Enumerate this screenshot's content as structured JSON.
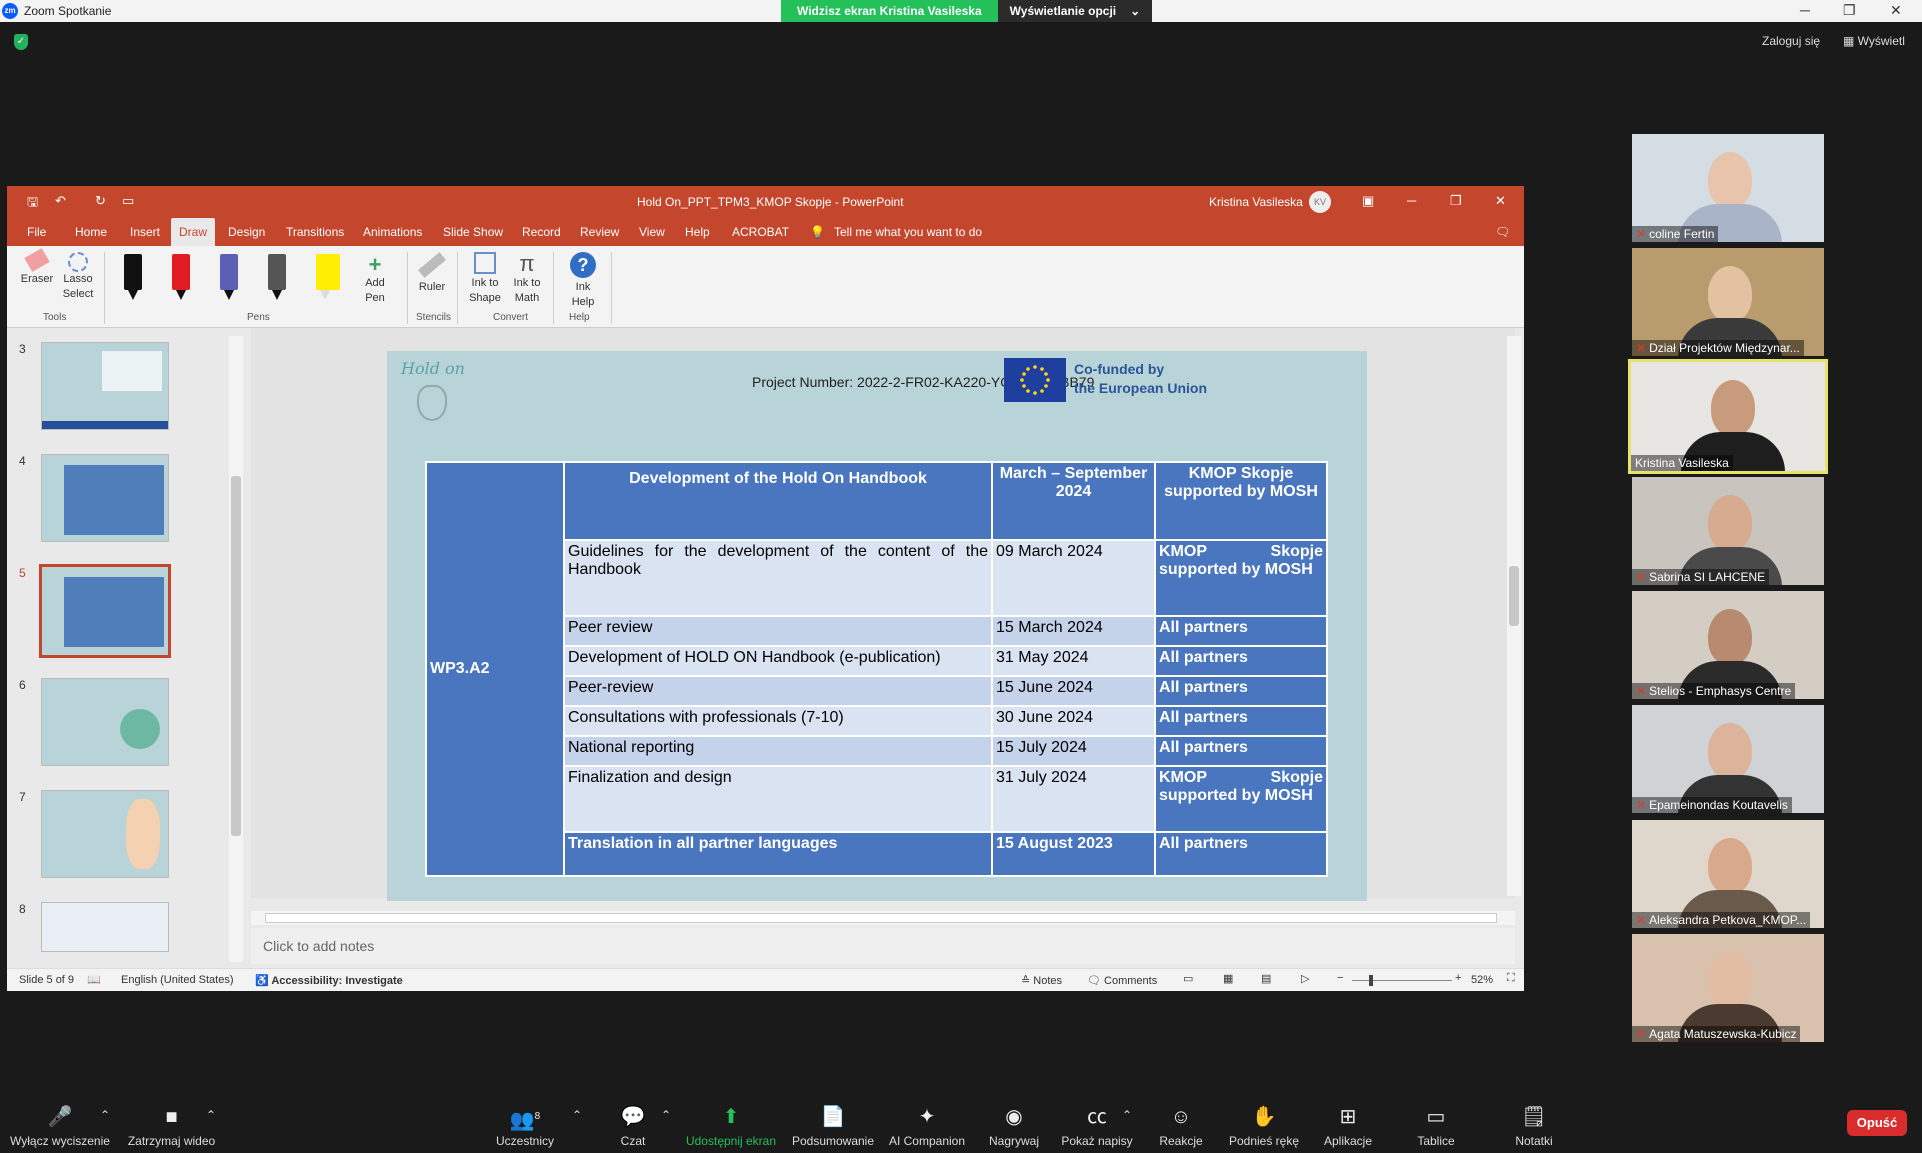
{
  "zoom": {
    "window_title": "Zoom Spotkanie",
    "app_icon": "zm",
    "share_banner": "Widzisz ekran Kristina Vasileska",
    "view_options": "Wyświetlanie opcji",
    "login": "Zaloguj się",
    "view": "Wyświetl"
  },
  "ppt": {
    "title": "Hold On_PPT_TPM3_KMOP Skopje  -  PowerPoint",
    "user": "Kristina Vasileska",
    "user_initials": "KV",
    "tabs": [
      "File",
      "Home",
      "Insert",
      "Draw",
      "Design",
      "Transitions",
      "Animations",
      "Slide Show",
      "Record",
      "Review",
      "View",
      "Help",
      "ACROBAT"
    ],
    "tell_me": "Tell me what you want to do",
    "ribbon": {
      "eraser": "Eraser",
      "lasso": "Lasso Select",
      "tools_group": "Tools",
      "add_pen": "Add Pen",
      "pens_group": "Pens",
      "ruler": "Ruler",
      "stencils_group": "Stencils",
      "ink_to_shape": "Ink to Shape",
      "ink_to_math": "Ink to Math",
      "convert_group": "Convert",
      "ink_help": "Ink Help",
      "help_group": "Help"
    },
    "thumbs": [
      "3",
      "4",
      "5",
      "6",
      "7",
      "8"
    ],
    "notes_placeholder": "Click to add notes",
    "status": {
      "slide": "Slide 5 of 9",
      "language": "English (United States)",
      "accessibility": "Accessibility: Investigate",
      "notes": "Notes",
      "comments": "Comments",
      "zoom": "52%"
    }
  },
  "slide": {
    "logo": "Hold on",
    "project_number": "Project Number: 2022-2-FR02-KA220-YOU-0B6EBB79",
    "eu_line1": "Co-funded by",
    "eu_line2": "the European Union",
    "wp": "WP3.A2",
    "header": {
      "activity": "Development of the Hold On Handbook",
      "date": "March – September 2024",
      "responsible": "KMOP Skopje supported   by MOSH"
    },
    "rows": [
      {
        "activity": "Guidelines for the development of the content of the Handbook",
        "date": "09 March 2024",
        "responsible": "KMOP Skopje supported by MOSH"
      },
      {
        "activity": "Peer review",
        "date": "15 March 2024",
        "responsible": "All partners"
      },
      {
        "activity": "Development of HOLD ON Handbook (e-publication)",
        "date": "31 May 2024",
        "responsible": "All partners"
      },
      {
        "activity": "Peer-review",
        "date": "15 June 2024",
        "responsible": "All partners"
      },
      {
        "activity": "Consultations with professionals (7-10)",
        "date": "30 June 2024",
        "responsible": "All partners"
      },
      {
        "activity": "National reporting",
        "date": "15 July 2024",
        "responsible": "All partners"
      },
      {
        "activity": "Finalization and design",
        "date": "31 July 2024",
        "responsible": "KMOP Skopje supported by MOSH"
      }
    ],
    "footer": {
      "activity": "Translation in all partner languages",
      "date": "15 August 2023",
      "responsible": "All partners"
    }
  },
  "participants": [
    {
      "name": "coline Fertin"
    },
    {
      "name": "Dział Projektów Międzynar..."
    },
    {
      "name": "Kristina Vasileska"
    },
    {
      "name": "Sabrina SI LAHCENE"
    },
    {
      "name": "Stelios - Emphasys Centre"
    },
    {
      "name": "Epameinondas Koutavelis"
    },
    {
      "name": "Aleksandra Petkova_KMOP..."
    },
    {
      "name": "Agata Matuszewska-Kubicz"
    }
  ],
  "toolbar": {
    "mute": "Wyłącz wyciszenie",
    "video": "Zatrzymaj wideo",
    "participants": "Uczestnicy",
    "participants_count": "8",
    "chat": "Czat",
    "share": "Udostępnij ekran",
    "summary": "Podsumowanie",
    "ai": "AI Companion",
    "record": "Nagrywaj",
    "captions": "Pokaż napisy",
    "reactions": "Reakcje",
    "raise_hand": "Podnieś rękę",
    "apps": "Aplikacje",
    "whiteboards": "Tablice",
    "notes": "Notatki",
    "leave": "Opuść"
  }
}
